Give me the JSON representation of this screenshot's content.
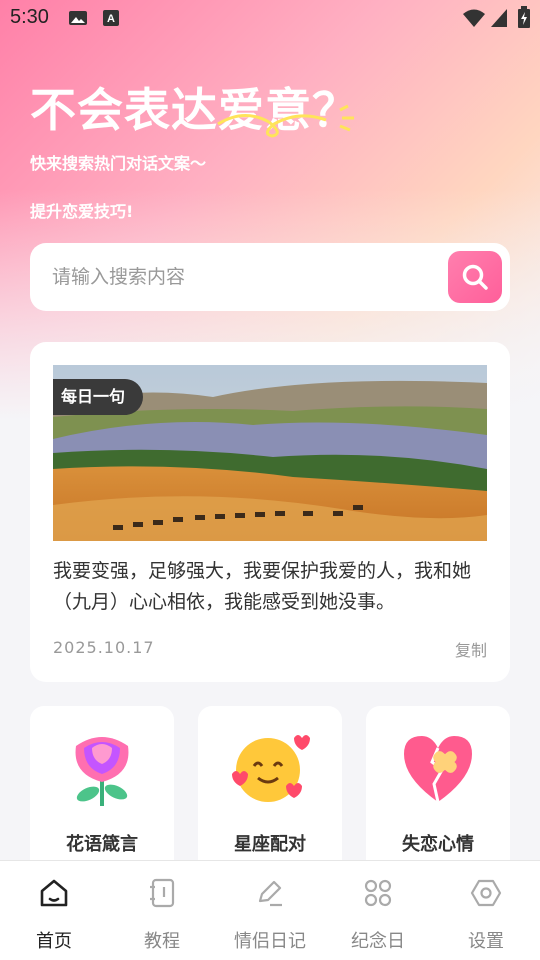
{
  "status_bar": {
    "time": "5:30"
  },
  "hero": {
    "title": "不会表达爱意？",
    "subtitle_1": "快来搜索热门对话文案～",
    "subtitle_2": "提升恋爱技巧!"
  },
  "search": {
    "placeholder": "请输入搜索内容",
    "value": ""
  },
  "daily": {
    "badge": "每日一句",
    "text": "我要变强，足够强大，我要保护我爱的人，我和她（九月）心心相依，我能感受到她没事。",
    "date": "2025.10.17",
    "copy_label": "复制"
  },
  "categories": [
    {
      "label": "花语箴言",
      "icon": "rose-icon"
    },
    {
      "label": "星座配对",
      "icon": "love-emoji-icon"
    },
    {
      "label": "失恋心情",
      "icon": "broken-heart-icon"
    }
  ],
  "tabs": [
    {
      "label": "首页",
      "icon": "home-icon",
      "active": true
    },
    {
      "label": "教程",
      "icon": "tutorial-icon",
      "active": false
    },
    {
      "label": "情侣日记",
      "icon": "diary-icon",
      "active": false
    },
    {
      "label": "纪念日",
      "icon": "anniversary-icon",
      "active": false
    },
    {
      "label": "设置",
      "icon": "settings-icon",
      "active": false
    }
  ],
  "colors": {
    "accent": "#ff6fa3",
    "text": "#333333",
    "muted": "#999999"
  }
}
